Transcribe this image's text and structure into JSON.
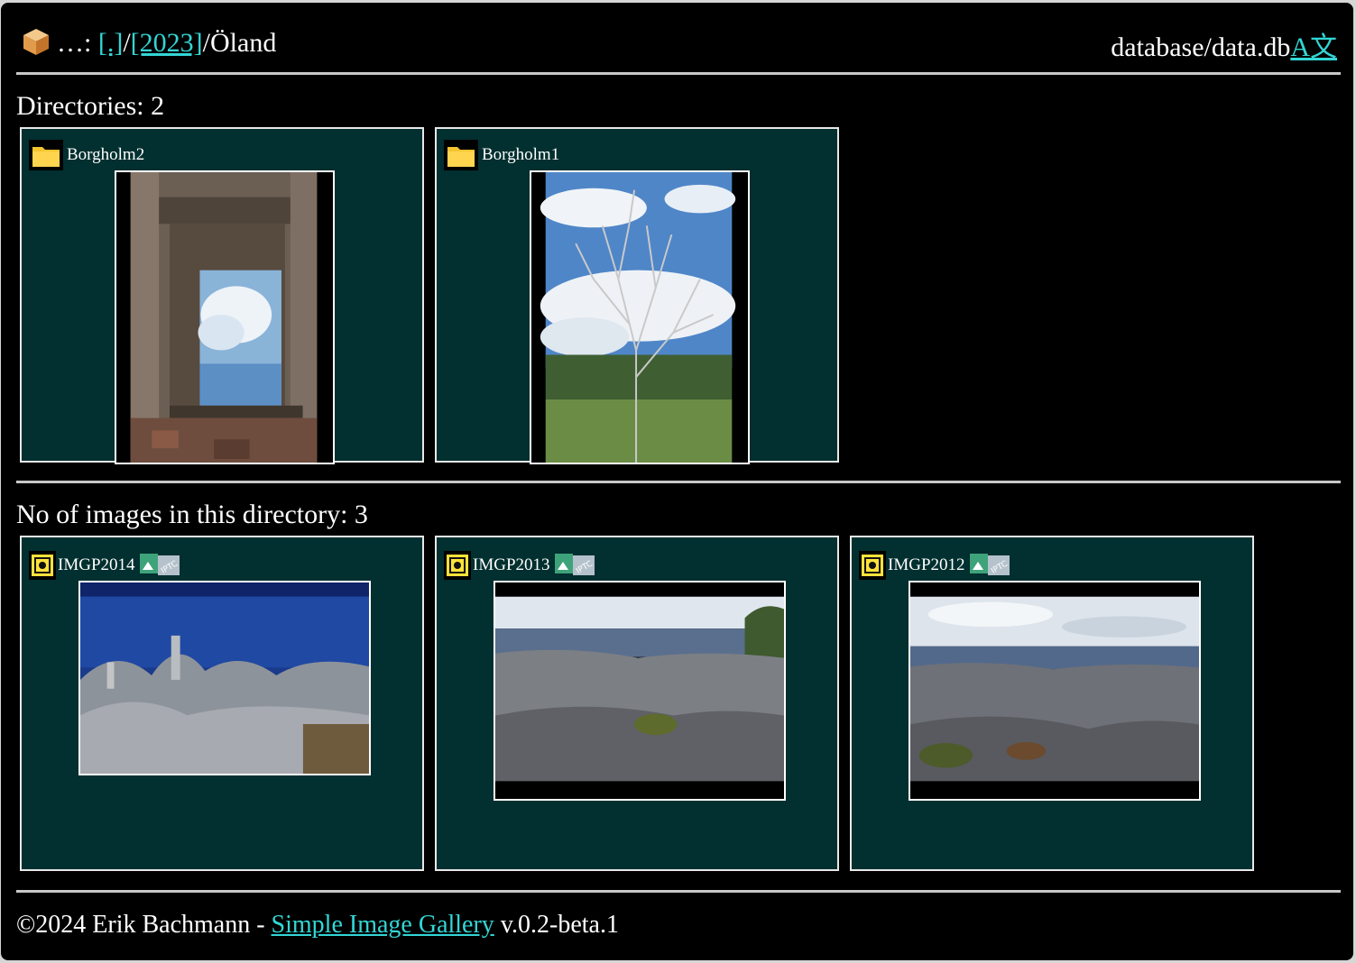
{
  "header": {
    "breadcrumb_prefix": "…:",
    "crumb_root": "[.]",
    "crumb_year": "[2023]",
    "current_dir": "Öland",
    "database_label": "database/data.db",
    "language_link": "A文"
  },
  "directories": {
    "heading": "Directories: 2",
    "items": [
      {
        "name": "Borgholm2",
        "icon": "folder-icon"
      },
      {
        "name": "Borgholm1",
        "icon": "folder-icon"
      }
    ]
  },
  "images": {
    "heading": "No of images in this directory: 3",
    "items": [
      {
        "name": "IMGP2014",
        "icon": "image-file-icon",
        "meta_icon": "exif-iptc-icon"
      },
      {
        "name": "IMGP2013",
        "icon": "image-file-icon",
        "meta_icon": "exif-iptc-icon"
      },
      {
        "name": "IMGP2012",
        "icon": "image-file-icon",
        "meta_icon": "exif-iptc-icon"
      }
    ]
  },
  "footer": {
    "copyright": "©2024 Erik Bachmann -",
    "app_link": "Simple Image Gallery",
    "version": "v.0.2-beta.1"
  },
  "colors": {
    "background": "#000000",
    "card_bg": "#022f2f",
    "link": "#33d6d6",
    "folder_yellow": "#f5c531"
  }
}
